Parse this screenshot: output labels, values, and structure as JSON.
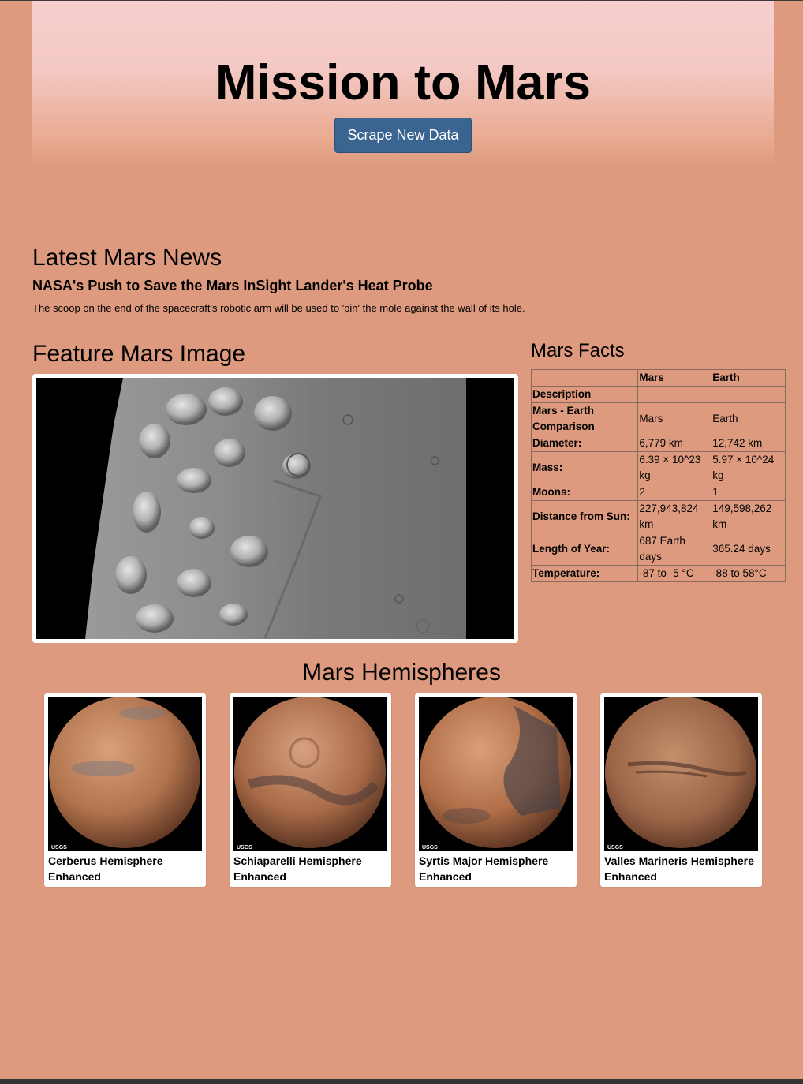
{
  "header": {
    "title": "Mission to Mars",
    "scrape_button": "Scrape New Data"
  },
  "news": {
    "section_title": "Latest Mars News",
    "headline": "NASA's Push to Save the Mars InSight Lander's Heat Probe",
    "teaser": "The scoop on the end of the spacecraft's robotic arm will be used to 'pin' the mole against the wall of its hole."
  },
  "feature": {
    "section_title": "Feature Mars Image"
  },
  "facts": {
    "section_title": "Mars Facts",
    "columns": [
      "",
      "Mars",
      "Earth"
    ],
    "rows": [
      {
        "label": "Description",
        "mars": "",
        "earth": ""
      },
      {
        "label": "Mars - Earth Comparison",
        "mars": "Mars",
        "earth": "Earth"
      },
      {
        "label": "Diameter:",
        "mars": "6,779 km",
        "earth": "12,742 km"
      },
      {
        "label": "Mass:",
        "mars": "6.39 × 10^23 kg",
        "earth": "5.97 × 10^24 kg"
      },
      {
        "label": "Moons:",
        "mars": "2",
        "earth": "1"
      },
      {
        "label": "Distance from Sun:",
        "mars": "227,943,824 km",
        "earth": "149,598,262 km"
      },
      {
        "label": "Length of Year:",
        "mars": "687 Earth days",
        "earth": "365.24 days"
      },
      {
        "label": "Temperature:",
        "mars": "-87 to -5 °C",
        "earth": "-88 to 58°C"
      }
    ]
  },
  "hemispheres": {
    "section_title": "Mars Hemispheres",
    "items": [
      {
        "title": "Cerberus Hemisphere Enhanced",
        "logo": "USGS"
      },
      {
        "title": "Schiaparelli Hemisphere Enhanced",
        "logo": "USGS"
      },
      {
        "title": "Syrtis Major Hemisphere Enhanced",
        "logo": "USGS"
      },
      {
        "title": "Valles Marineris Hemisphere Enhanced",
        "logo": "USGS"
      }
    ]
  },
  "colors": {
    "page_background": "#dd9a7e",
    "jumbotron_top": "#f7cfcf",
    "button": "#3a6591"
  }
}
